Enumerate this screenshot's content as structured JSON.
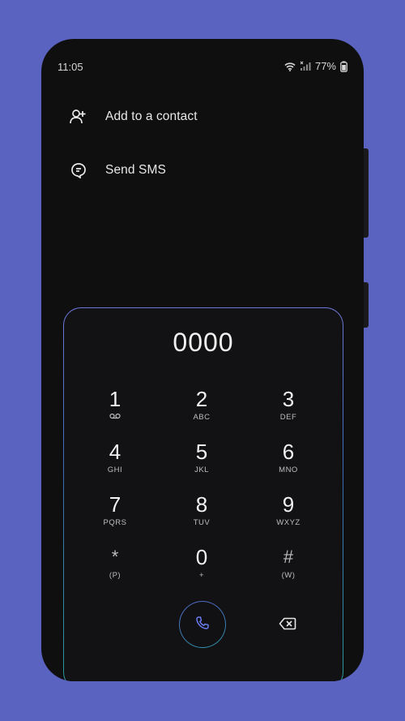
{
  "status_bar": {
    "time": "11:05",
    "battery_percent": "77%",
    "icons": [
      "wifi-icon",
      "signal-icon",
      "battery-icon"
    ]
  },
  "menu": {
    "items": [
      {
        "label": "Add to a contact",
        "icon": "add-contact-icon"
      },
      {
        "label": "Send SMS",
        "icon": "sms-icon"
      }
    ]
  },
  "dialer": {
    "number": "0000",
    "keys": [
      {
        "digit": "1",
        "letters": "voicemail-icon"
      },
      {
        "digit": "2",
        "letters": "ABC"
      },
      {
        "digit": "3",
        "letters": "DEF"
      },
      {
        "digit": "4",
        "letters": "GHI"
      },
      {
        "digit": "5",
        "letters": "JKL"
      },
      {
        "digit": "6",
        "letters": "MNO"
      },
      {
        "digit": "7",
        "letters": "PQRS"
      },
      {
        "digit": "8",
        "letters": "TUV"
      },
      {
        "digit": "9",
        "letters": "WXYZ"
      },
      {
        "digit": "*",
        "letters": "(P)"
      },
      {
        "digit": "0",
        "letters": "+"
      },
      {
        "digit": "#",
        "letters": "(W)"
      }
    ],
    "call_icon": "phone-icon",
    "backspace_icon": "backspace-icon"
  },
  "colors": {
    "background": "#5b63c0",
    "phone": "#0f0f10",
    "accent": "#5a6bd6",
    "accent_teal": "#2a9a9a"
  }
}
